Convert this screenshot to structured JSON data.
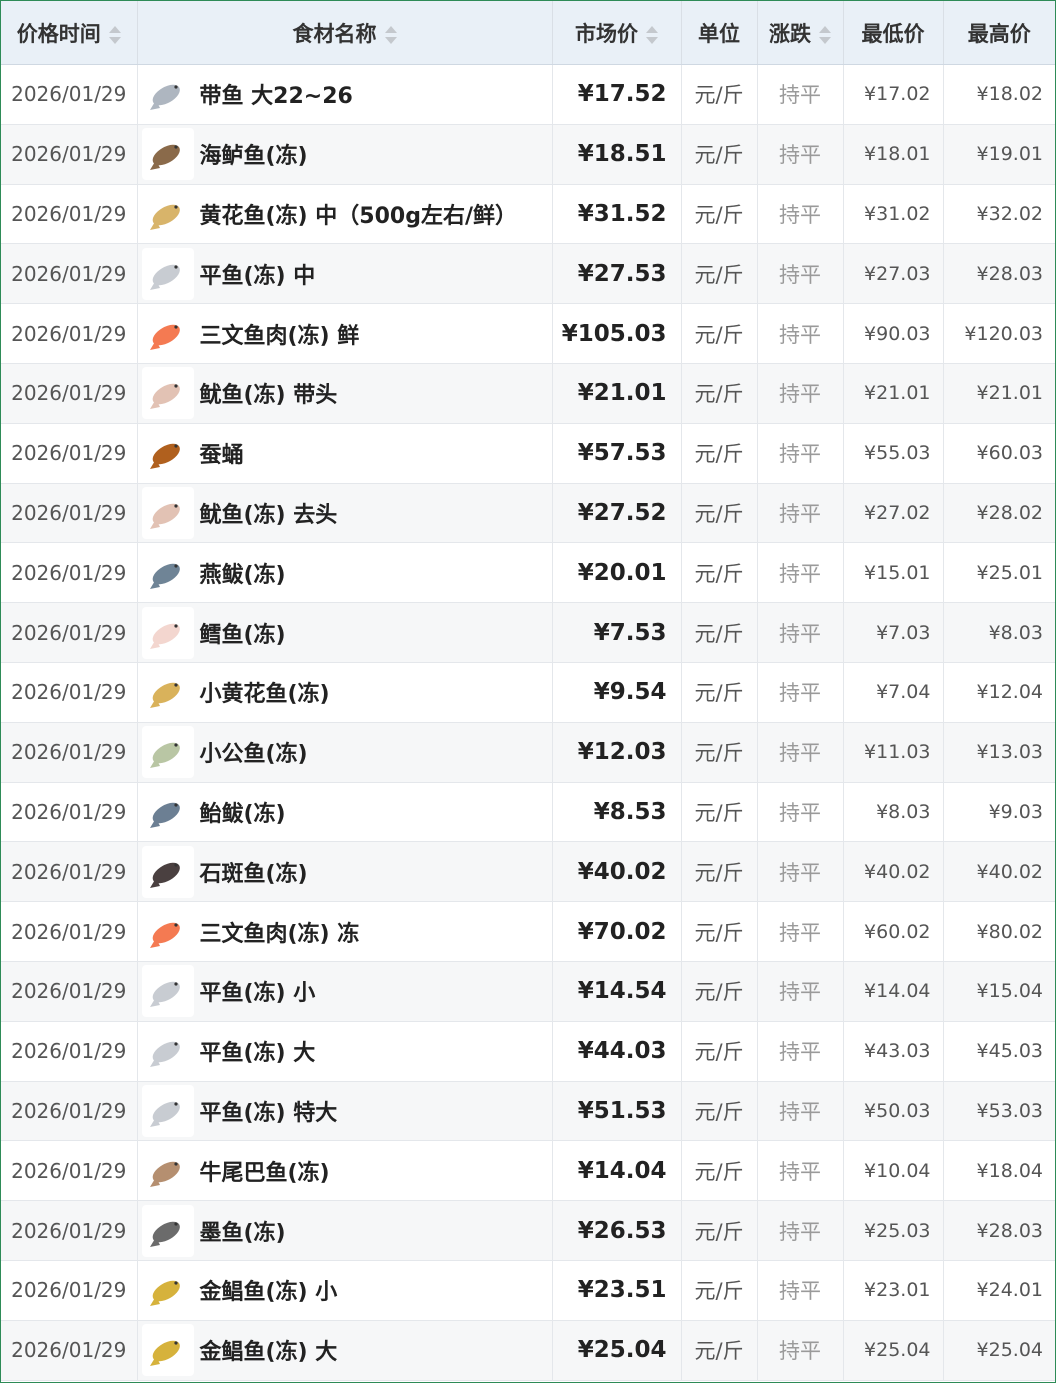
{
  "headers": {
    "date": "价格时间",
    "name": "食材名称",
    "price": "市场价",
    "unit": "单位",
    "trend": "涨跌",
    "min": "最低价",
    "max": "最高价"
  },
  "rows": [
    {
      "date": "2026/01/29",
      "name": "带鱼 大22~26",
      "icon": "hairtail-fish-icon",
      "price": "¥17.52",
      "unit": "元/斤",
      "trend": "持平",
      "min": "¥17.02",
      "max": "¥18.02"
    },
    {
      "date": "2026/01/29",
      "name": "海鲈鱼(冻)",
      "icon": "sea-bass-icon",
      "price": "¥18.51",
      "unit": "元/斤",
      "trend": "持平",
      "min": "¥18.01",
      "max": "¥19.01"
    },
    {
      "date": "2026/01/29",
      "name": "黄花鱼(冻) 中（500g左右/鲜）",
      "icon": "yellow-croaker-icon",
      "price": "¥31.52",
      "unit": "元/斤",
      "trend": "持平",
      "min": "¥31.02",
      "max": "¥32.02"
    },
    {
      "date": "2026/01/29",
      "name": "平鱼(冻) 中",
      "icon": "pomfret-icon",
      "price": "¥27.53",
      "unit": "元/斤",
      "trend": "持平",
      "min": "¥27.03",
      "max": "¥28.03"
    },
    {
      "date": "2026/01/29",
      "name": "三文鱼肉(冻) 鲜",
      "icon": "salmon-fillet-icon",
      "price": "¥105.03",
      "unit": "元/斤",
      "trend": "持平",
      "min": "¥90.03",
      "max": "¥120.03"
    },
    {
      "date": "2026/01/29",
      "name": "鱿鱼(冻) 带头",
      "icon": "squid-icon",
      "price": "¥21.01",
      "unit": "元/斤",
      "trend": "持平",
      "min": "¥21.01",
      "max": "¥21.01"
    },
    {
      "date": "2026/01/29",
      "name": "蚕蛹",
      "icon": "silkworm-pupa-icon",
      "price": "¥57.53",
      "unit": "元/斤",
      "trend": "持平",
      "min": "¥55.03",
      "max": "¥60.03"
    },
    {
      "date": "2026/01/29",
      "name": "鱿鱼(冻) 去头",
      "icon": "squid-icon",
      "price": "¥27.52",
      "unit": "元/斤",
      "trend": "持平",
      "min": "¥27.02",
      "max": "¥28.02"
    },
    {
      "date": "2026/01/29",
      "name": "燕鲅(冻)",
      "icon": "mackerel-icon",
      "price": "¥20.01",
      "unit": "元/斤",
      "trend": "持平",
      "min": "¥15.01",
      "max": "¥25.01"
    },
    {
      "date": "2026/01/29",
      "name": "鳕鱼(冻)",
      "icon": "cod-fillet-icon",
      "price": "¥7.53",
      "unit": "元/斤",
      "trend": "持平",
      "min": "¥7.03",
      "max": "¥8.03"
    },
    {
      "date": "2026/01/29",
      "name": "小黄花鱼(冻)",
      "icon": "small-croaker-icon",
      "price": "¥9.54",
      "unit": "元/斤",
      "trend": "持平",
      "min": "¥7.04",
      "max": "¥12.04"
    },
    {
      "date": "2026/01/29",
      "name": "小公鱼(冻)",
      "icon": "anchovy-icon",
      "price": "¥12.03",
      "unit": "元/斤",
      "trend": "持平",
      "min": "¥11.03",
      "max": "¥13.03"
    },
    {
      "date": "2026/01/29",
      "name": "鲐鲅(冻)",
      "icon": "chub-mackerel-icon",
      "price": "¥8.53",
      "unit": "元/斤",
      "trend": "持平",
      "min": "¥8.03",
      "max": "¥9.03"
    },
    {
      "date": "2026/01/29",
      "name": "石斑鱼(冻)",
      "icon": "grouper-icon",
      "price": "¥40.02",
      "unit": "元/斤",
      "trend": "持平",
      "min": "¥40.02",
      "max": "¥40.02"
    },
    {
      "date": "2026/01/29",
      "name": "三文鱼肉(冻) 冻",
      "icon": "salmon-fillet-icon",
      "price": "¥70.02",
      "unit": "元/斤",
      "trend": "持平",
      "min": "¥60.02",
      "max": "¥80.02"
    },
    {
      "date": "2026/01/29",
      "name": "平鱼(冻) 小",
      "icon": "pomfret-icon",
      "price": "¥14.54",
      "unit": "元/斤",
      "trend": "持平",
      "min": "¥14.04",
      "max": "¥15.04"
    },
    {
      "date": "2026/01/29",
      "name": "平鱼(冻) 大",
      "icon": "pomfret-icon",
      "price": "¥44.03",
      "unit": "元/斤",
      "trend": "持平",
      "min": "¥43.03",
      "max": "¥45.03"
    },
    {
      "date": "2026/01/29",
      "name": "平鱼(冻) 特大",
      "icon": "pomfret-icon",
      "price": "¥51.53",
      "unit": "元/斤",
      "trend": "持平",
      "min": "¥50.03",
      "max": "¥53.03"
    },
    {
      "date": "2026/01/29",
      "name": "牛尾巴鱼(冻)",
      "icon": "flathead-fish-icon",
      "price": "¥14.04",
      "unit": "元/斤",
      "trend": "持平",
      "min": "¥10.04",
      "max": "¥18.04"
    },
    {
      "date": "2026/01/29",
      "name": "墨鱼(冻)",
      "icon": "cuttlefish-icon",
      "price": "¥26.53",
      "unit": "元/斤",
      "trend": "持平",
      "min": "¥25.03",
      "max": "¥28.03"
    },
    {
      "date": "2026/01/29",
      "name": "金鲳鱼(冻) 小",
      "icon": "golden-pompano-icon",
      "price": "¥23.51",
      "unit": "元/斤",
      "trend": "持平",
      "min": "¥23.01",
      "max": "¥24.01"
    },
    {
      "date": "2026/01/29",
      "name": "金鲳鱼(冻) 大",
      "icon": "golden-pompano-icon",
      "price": "¥25.04",
      "unit": "元/斤",
      "trend": "持平",
      "min": "¥25.04",
      "max": "¥25.04"
    }
  ],
  "icon_colors": {
    "hairtail-fish-icon": "#aeb6c0",
    "sea-bass-icon": "#8a6a4a",
    "yellow-croaker-icon": "#d8b46a",
    "pomfret-icon": "#c8ccd2",
    "salmon-fillet-icon": "#f47a52",
    "squid-icon": "#e2c2b4",
    "silkworm-pupa-icon": "#b0601e",
    "mackerel-icon": "#6f8496",
    "cod-fillet-icon": "#f3d6cf",
    "small-croaker-icon": "#d9b25b",
    "anchovy-icon": "#b9c6a4",
    "chub-mackerel-icon": "#6c7f93",
    "grouper-icon": "#4a4040",
    "flathead-fish-icon": "#b58f70",
    "cuttlefish-icon": "#6b6b6b",
    "golden-pompano-icon": "#d6b23c"
  },
  "colors": {
    "header_bg": "#e9f0f7",
    "border": "#2e8b57",
    "trend_text": "#9a9a9a"
  }
}
